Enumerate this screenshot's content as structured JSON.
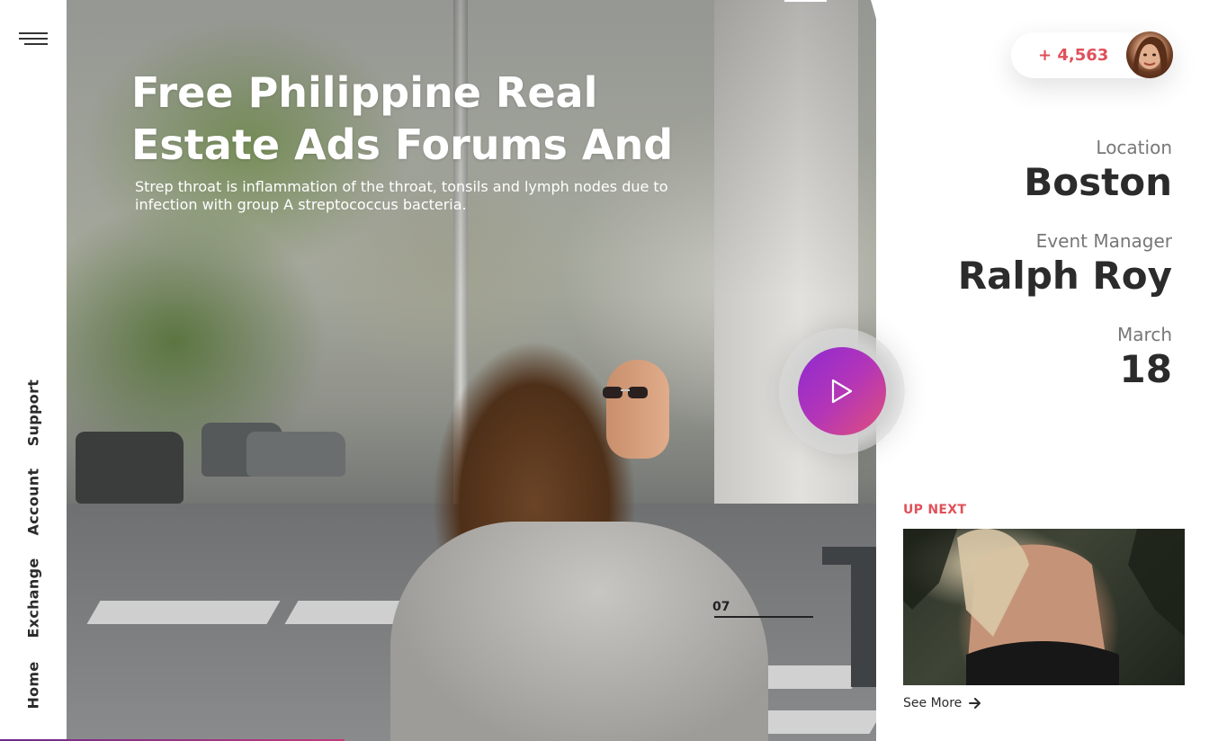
{
  "nav": {
    "menu_icon": "hamburger-icon",
    "items": [
      {
        "label": "Home"
      },
      {
        "label": "Exchange"
      },
      {
        "label": "Account"
      },
      {
        "label": "Support"
      }
    ]
  },
  "hero": {
    "title_line1": "Free Philippine Real",
    "title_line2": "Estate Ads Forums And",
    "description": "Strep throat is inflammation of the throat, tonsils and lymph nodes due to infection with group A streptococcus bacteria."
  },
  "slider": {
    "current": "07",
    "big_number": "1"
  },
  "play": {
    "icon": "play-icon"
  },
  "stat": {
    "value": "+ 4,563"
  },
  "details": {
    "location_label": "Location",
    "location_value": "Boston",
    "manager_label": "Event Manager",
    "manager_value": "Ralph Roy",
    "month_label": "March",
    "day_value": "18"
  },
  "up_next": {
    "label": "UP NEXT",
    "see_more": "See More",
    "arrow_icon": "arrow-right-icon"
  },
  "colors": {
    "accent": "#e0505a",
    "play_gradient_start": "#8d2ad1",
    "play_gradient_end": "#e0507a",
    "text_dark": "#2b2b2b"
  }
}
